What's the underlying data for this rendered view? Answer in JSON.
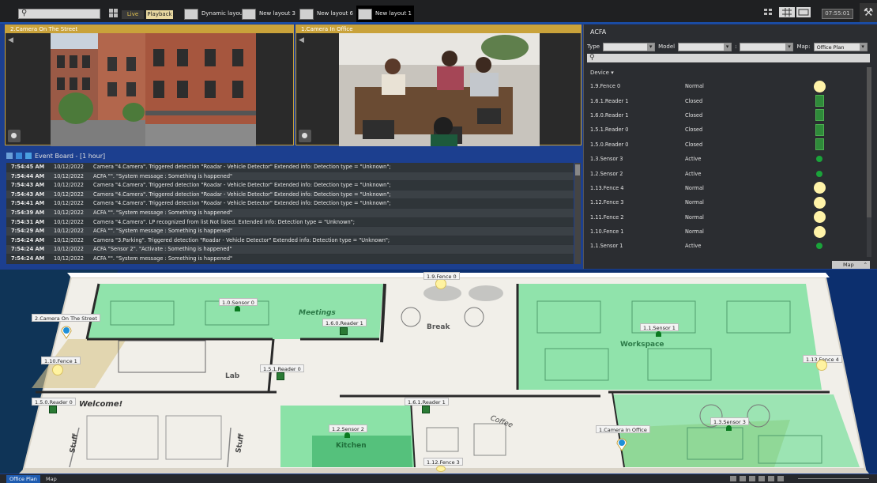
{
  "topbar": {
    "search_placeholder": "",
    "live_label": "Live",
    "playback_label": "Playback",
    "layouts": [
      {
        "label": "Dynamic layout"
      },
      {
        "label": "New layout 3"
      },
      {
        "label": "New layout 6"
      },
      {
        "label": "New layout 1"
      }
    ],
    "clock": "07:55:01"
  },
  "cameras": [
    {
      "title": "2.Camera On The Street"
    },
    {
      "title": "1.Camera In Office"
    }
  ],
  "event_board": {
    "title": "Event Board - [1 hour]",
    "rows": [
      {
        "time": "7:54:45 AM",
        "date": "10/12/2022",
        "msg": "Camera \"4.Camera\". Triggered detection \"Roadar - Vehicle Detector\" Extended info: Detection type = \"Unknown\";"
      },
      {
        "time": "7:54:44 AM",
        "date": "10/12/2022",
        "msg": "ACFA \"\". \"System message : Something is happened\""
      },
      {
        "time": "7:54:43 AM",
        "date": "10/12/2022",
        "msg": "Camera \"4.Camera\". Triggered detection \"Roadar - Vehicle Detector\" Extended info: Detection type = \"Unknown\";"
      },
      {
        "time": "7:54:43 AM",
        "date": "10/12/2022",
        "msg": "Camera \"4.Camera\". Triggered detection \"Roadar - Vehicle Detector\" Extended info: Detection type = \"Unknown\";"
      },
      {
        "time": "7:54:41 AM",
        "date": "10/12/2022",
        "msg": "Camera \"4.Camera\". Triggered detection \"Roadar - Vehicle Detector\" Extended info: Detection type = \"Unknown\";"
      },
      {
        "time": "7:54:39 AM",
        "date": "10/12/2022",
        "msg": "ACFA \"\". \"System message : Something is happened\""
      },
      {
        "time": "7:54:31 AM",
        "date": "10/12/2022",
        "msg": "Camera \"4.Camera\". LP recognized from list Not listed. Extended info: Detection type = \"Unknown\";"
      },
      {
        "time": "7:54:29 AM",
        "date": "10/12/2022",
        "msg": "ACFA \"\". \"System message : Something is happened\""
      },
      {
        "time": "7:54:24 AM",
        "date": "10/12/2022",
        "msg": "Camera \"3.Parking\". Triggered detection \"Roadar - Vehicle Detector\" Extended info: Detection type = \"Unknown\";"
      },
      {
        "time": "7:54:24 AM",
        "date": "10/12/2022",
        "msg": "ACFA \"Sensor 2\". \"Activate : Something is happened\""
      },
      {
        "time": "7:54:24 AM",
        "date": "10/12/2022",
        "msg": "ACFA \"\". \"System message : Something is happened\""
      }
    ]
  },
  "acfa": {
    "title": "ACFA",
    "type_label": "Type",
    "model_label": "Model",
    "map_label": "Map:",
    "map_value": "Office Plan",
    "device_header": "Device",
    "devices": [
      {
        "name": "1.9.Fence 0",
        "state": "Normal",
        "kind": "fence"
      },
      {
        "name": "1.6.1.Reader 1",
        "state": "Closed",
        "kind": "reader"
      },
      {
        "name": "1.6.0.Reader 1",
        "state": "Closed",
        "kind": "reader"
      },
      {
        "name": "1.5.1.Reader 0",
        "state": "Closed",
        "kind": "reader"
      },
      {
        "name": "1.5.0.Reader 0",
        "state": "Closed",
        "kind": "reader"
      },
      {
        "name": "1.3.Sensor 3",
        "state": "Active",
        "kind": "sensor"
      },
      {
        "name": "1.2.Sensor 2",
        "state": "Active",
        "kind": "sensor"
      },
      {
        "name": "1.13.Fence 4",
        "state": "Normal",
        "kind": "fence"
      },
      {
        "name": "1.12.Fence 3",
        "state": "Normal",
        "kind": "fence"
      },
      {
        "name": "1.11.Fence 2",
        "state": "Normal",
        "kind": "fence"
      },
      {
        "name": "1.10.Fence 1",
        "state": "Normal",
        "kind": "fence"
      },
      {
        "name": "1.1.Sensor 1",
        "state": "Active",
        "kind": "sensor"
      }
    ],
    "map_button": "Map"
  },
  "floor": {
    "rooms": {
      "meetings": "Meetings",
      "break": "Break",
      "workspace": "Workspace",
      "lab": "Lab",
      "welcome": "Welcome!",
      "coffee": "Coffee",
      "kitchen": "Kitchen",
      "stuff_left": "Stuff",
      "stuff_mid": "Stuff"
    },
    "labels": {
      "fence0": "1.9.Fence 0",
      "sensor0": "1.0.Sensor 0",
      "reader160": "1.6.0.Reader 1",
      "sensor1": "1.1.Sensor 1",
      "cam_street": "2.Camera On The Street",
      "fence1": "1.10.Fence 1",
      "reader151": "1.5.1.Reader 0",
      "fence4": "1.13.Fence 4",
      "reader150": "1.5.0.Reader 0",
      "reader161": "1.6.1.Reader 1",
      "sensor2": "1.2.Sensor 2",
      "cam_office": "1.Camera In Office",
      "sensor3": "1.3.Sensor 3",
      "fence3": "1.12.Fence 3"
    }
  },
  "bottombar": {
    "tabs": [
      {
        "label": "Office Plan"
      },
      {
        "label": "Map"
      }
    ]
  }
}
